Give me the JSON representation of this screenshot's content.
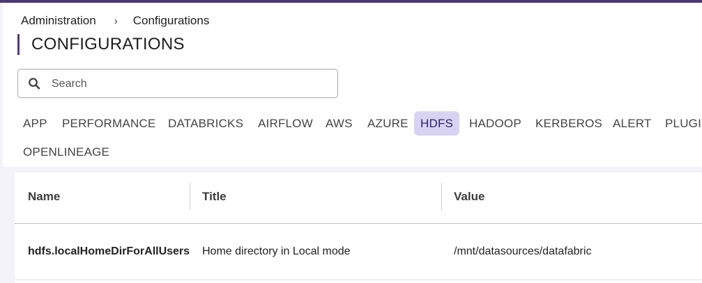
{
  "breadcrumb": {
    "items": [
      "Administration",
      "Configurations"
    ],
    "separator": "›"
  },
  "page_title": "CONFIGURATIONS",
  "search": {
    "placeholder": "Search",
    "value": ""
  },
  "tabs": [
    {
      "label": "APP",
      "active": false
    },
    {
      "label": "PERFORMANCE",
      "active": false
    },
    {
      "label": "DATABRICKS",
      "active": false
    },
    {
      "label": "AIRFLOW",
      "active": false
    },
    {
      "label": "AWS",
      "active": false
    },
    {
      "label": "AZURE",
      "active": false
    },
    {
      "label": "HDFS",
      "active": true
    },
    {
      "label": "HADOOP",
      "active": false
    },
    {
      "label": "KERBEROS",
      "active": false
    },
    {
      "label": "ALERT",
      "active": false
    },
    {
      "label": "PLUGIN",
      "active": false
    },
    {
      "label": "OPENLINEAGE",
      "active": false
    }
  ],
  "table": {
    "columns": [
      "Name",
      "Title",
      "Value"
    ],
    "rows": [
      {
        "name": "hdfs.localHomeDirForAllUsers",
        "title": "Home directory in Local mode",
        "value": "/mnt/datasources/datafabric"
      }
    ]
  },
  "colors": {
    "accent": "#4e3d7e",
    "active_tab_bg": "#d9d3f3",
    "active_tab_text": "#2b1d6b",
    "top_bar": "#4a3a6e"
  }
}
